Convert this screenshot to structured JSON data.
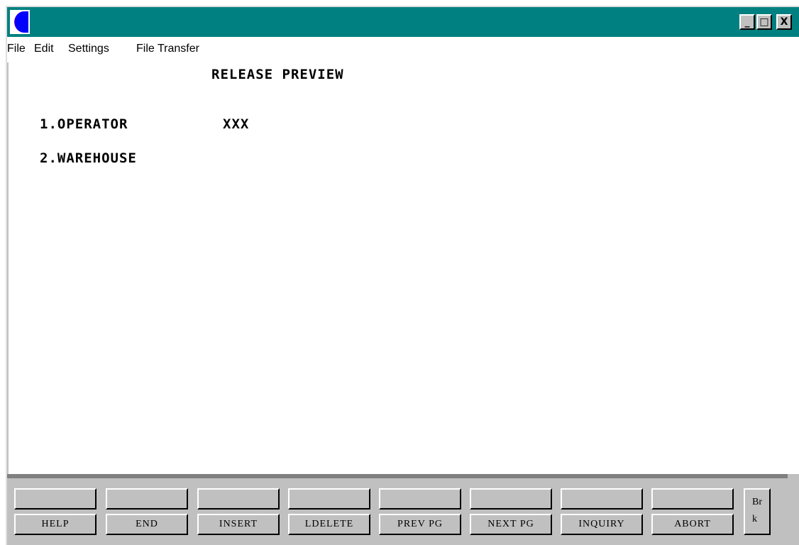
{
  "titlebar": {
    "icon": "terminal-emulator-icon",
    "minimize_label": "_",
    "maximize_label": "□",
    "close_label": "X"
  },
  "menu": [
    {
      "label": "File"
    },
    {
      "label": "Edit"
    },
    {
      "label": "Settings"
    },
    {
      "label": "File Transfer"
    }
  ],
  "screen": {
    "title": "RELEASE PREVIEW",
    "fields": [
      {
        "label": "1.OPERATOR",
        "value": "XXX"
      },
      {
        "label": "2.WAREHOUSE",
        "value": ""
      }
    ]
  },
  "function_keys": {
    "top_row": [
      "",
      "",
      "",
      "",
      "",
      "",
      "",
      ""
    ],
    "bottom_row": [
      "HELP",
      "END",
      "INSERT",
      "LDELETE",
      "PREV PG",
      "NEXT PG",
      "INQUIRY",
      "ABORT"
    ],
    "brk_line1": "Br",
    "brk_line2": "k"
  },
  "colors": {
    "titlebar": "#008080",
    "chrome": "#c0c0c0",
    "screen_bg": "#ffffff"
  }
}
